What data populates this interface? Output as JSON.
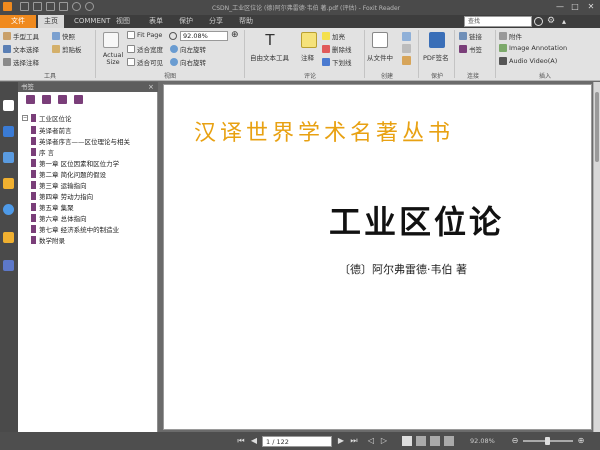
{
  "window": {
    "title": "CSDN_工业区位论 (德)阿尔弗雷德·韦伯 著.pdf (评估) - Foxit Reader",
    "minimize": "—",
    "maximize": "□",
    "close": "✕"
  },
  "menu": {
    "file": "文件",
    "tabs": [
      "主页",
      "COMMENT",
      "视图",
      "表单",
      "保护",
      "分享",
      "帮助"
    ],
    "active_index": 0
  },
  "search": {
    "value": "查找"
  },
  "ribbon": {
    "tools": {
      "hand": "手型工具",
      "select_text": "文本选择",
      "snapshot": "快照",
      "clipboard": "剪贴板",
      "select_annot": "选择注释",
      "group": "工具"
    },
    "view": {
      "actual_size": "Actual Size",
      "fit_page": "Fit Page",
      "fit_width": "适合宽度",
      "fit_visible": "适合可见",
      "zoom_value": "92.08%",
      "rotate_left": "向左旋转",
      "rotate_right": "向右旋转",
      "group": "视图"
    },
    "comment": {
      "typewriter": "自由文本工具",
      "note": "注释",
      "highlight": "加亮",
      "strikeout": "删除线",
      "underline": "下划线",
      "group": "评论"
    },
    "create": {
      "from_file": "从文件中",
      "group": "创建"
    },
    "protect": {
      "pdf_sign": "PDF签名",
      "group": "保护"
    },
    "links": {
      "link": "链接",
      "bookmark": "书签",
      "group": "连接"
    },
    "insert": {
      "attachment": "附件",
      "image_annotation": "Image Annotation",
      "audio_video": "Audio Video(A)",
      "group": "插入"
    }
  },
  "bookmarks": {
    "header": "书签",
    "root": "工业区位论",
    "items": [
      "英译者前言",
      "英译者序言——区位理论与相关",
      "序 言",
      "第一章 区位因素和区位力学",
      "第二章 简化问题的假设",
      "第三章 运输指向",
      "第四章 劳动力指向",
      "第五章 集聚",
      "第六章 总体指向",
      "第七章 经济系统中的制造业",
      "数学附录"
    ]
  },
  "document": {
    "series": "汉译世界学术名著丛书",
    "title": "工业区位论",
    "author": "〔德〕阿尔弗雷德·韦伯 著"
  },
  "status": {
    "page_display": "1 / 122",
    "zoom_display": "92.08%"
  },
  "colors": {
    "accent": "#f08a1e",
    "series_text": "#e8a112",
    "bookmark_flag": "#7a3e79"
  }
}
